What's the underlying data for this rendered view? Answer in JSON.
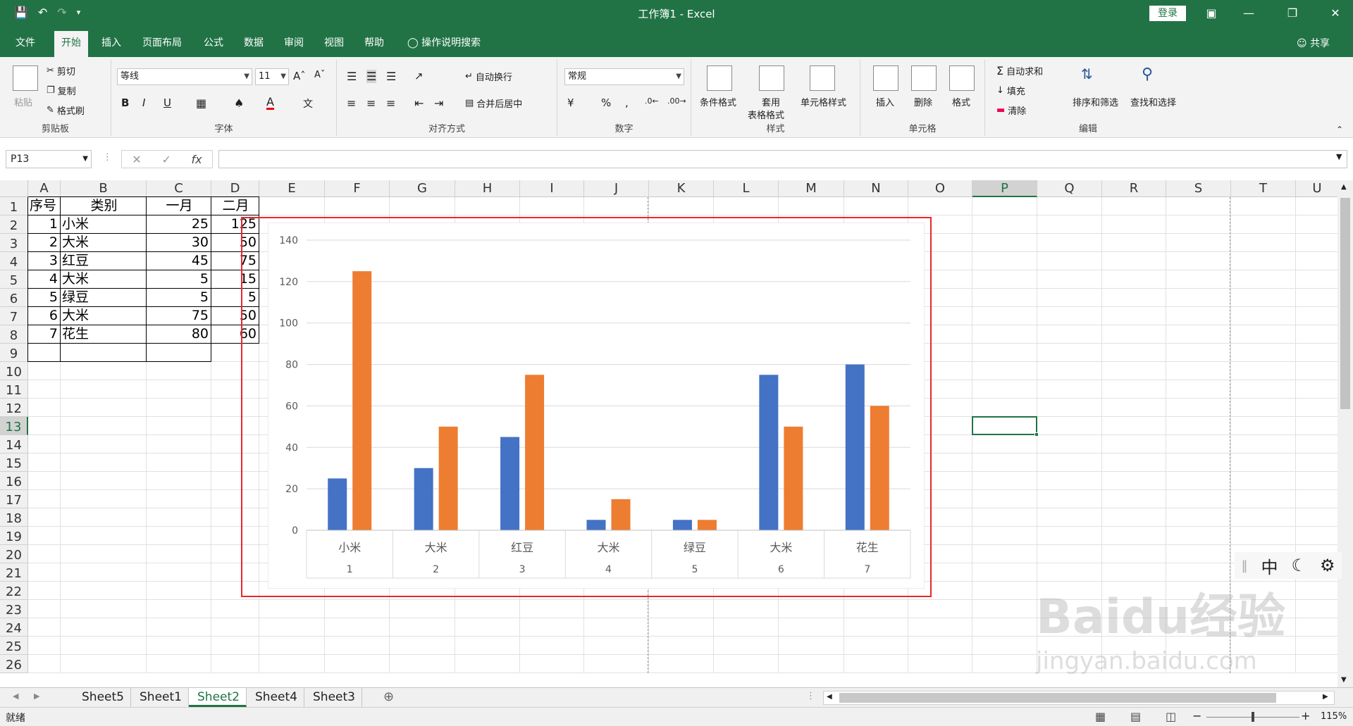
{
  "window": {
    "title": "工作簿1  -  Excel",
    "login": "登录"
  },
  "tabs": [
    "文件",
    "开始",
    "插入",
    "页面布局",
    "公式",
    "数据",
    "审阅",
    "视图",
    "帮助",
    "操作说明搜索"
  ],
  "share": "共享",
  "ribbon": {
    "clipboard": {
      "label": "剪贴板",
      "paste": "粘贴",
      "cut": "剪切",
      "copy": "复制",
      "format_painter": "格式刷"
    },
    "font": {
      "label": "字体",
      "name": "等线",
      "size": "11",
      "bold": "B",
      "italic": "I",
      "underline": "U"
    },
    "alignment": {
      "label": "对齐方式",
      "wrap": "自动换行",
      "merge": "合并后居中"
    },
    "number": {
      "label": "数字",
      "format": "常规",
      "percent": "%",
      "comma": ","
    },
    "styles": {
      "label": "样式",
      "conditional": "条件格式",
      "table_fmt_1": "套用",
      "table_fmt_2": "表格格式",
      "cell_styles": "单元格样式"
    },
    "cells": {
      "label": "单元格",
      "insert": "插入",
      "delete": "删除",
      "format": "格式"
    },
    "editing": {
      "label": "编辑",
      "autosum": "自动求和",
      "fill": "填充",
      "clear": "清除",
      "sort": "排序和筛选",
      "find": "查找和选择"
    }
  },
  "formula_bar": {
    "name_box": "P13",
    "fx": "fx",
    "content": ""
  },
  "columns": [
    "A",
    "B",
    "C",
    "D",
    "E",
    "F",
    "G",
    "H",
    "I",
    "J",
    "K",
    "L",
    "M",
    "N",
    "O",
    "P",
    "Q",
    "R",
    "S",
    "T",
    "U"
  ],
  "rows": [
    "1",
    "2",
    "3",
    "4",
    "5",
    "6",
    "7",
    "8",
    "9",
    "10",
    "11",
    "12",
    "13",
    "14",
    "15",
    "16",
    "17",
    "18",
    "19",
    "20",
    "21",
    "22",
    "23",
    "24",
    "25",
    "26"
  ],
  "selected_cell": {
    "col": "P",
    "row": "13"
  },
  "table": {
    "headers": [
      "序号",
      "类别",
      "一月",
      "二月"
    ],
    "rows": [
      [
        "1",
        "小米",
        "25",
        "125"
      ],
      [
        "2",
        "大米",
        "30",
        "50"
      ],
      [
        "3",
        "红豆",
        "45",
        "75"
      ],
      [
        "4",
        "大米",
        "5",
        "15"
      ],
      [
        "5",
        "绿豆",
        "5",
        "5"
      ],
      [
        "6",
        "大米",
        "75",
        "50"
      ],
      [
        "7",
        "花生",
        "80",
        "60"
      ]
    ]
  },
  "chart_data": {
    "type": "bar",
    "categories": [
      "小米",
      "大米",
      "红豆",
      "大米",
      "绿豆",
      "大米",
      "花生"
    ],
    "category_index": [
      "1",
      "2",
      "3",
      "4",
      "5",
      "6",
      "7"
    ],
    "series": [
      {
        "values": [
          25,
          30,
          45,
          5,
          5,
          75,
          80
        ],
        "color": "#4472c4"
      },
      {
        "values": [
          125,
          50,
          75,
          15,
          5,
          50,
          60
        ],
        "color": "#ed7d31"
      }
    ],
    "ylim": [
      0,
      140
    ],
    "yticks": [
      0,
      20,
      40,
      60,
      80,
      100,
      120,
      140
    ],
    "grid": true,
    "legend": "none"
  },
  "sheet_tabs": [
    "Sheet5",
    "Sheet1",
    "Sheet2",
    "Sheet4",
    "Sheet3"
  ],
  "active_sheet": "Sheet2",
  "status": {
    "ready": "就绪",
    "zoom": "115%"
  },
  "ime": {
    "mode": "中"
  },
  "colors": {
    "excel_green": "#217346",
    "selection_red": "#e8282b"
  },
  "watermark": {
    "brand": "Baidu经验",
    "url": "jingyan.baidu.com"
  }
}
